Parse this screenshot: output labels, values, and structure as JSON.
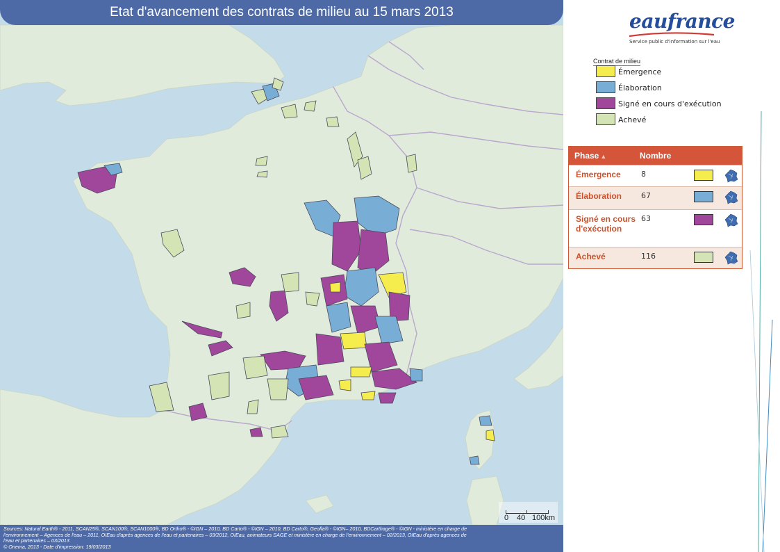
{
  "header": {
    "title": "Etat d'avancement des contrats de milieu au 15 mars 2013"
  },
  "brand": {
    "name": "eaufrance",
    "tagline": "Service public d'information sur l'eau"
  },
  "legend": {
    "title": "Contrat de milieu",
    "items": [
      {
        "label": "Émergence",
        "color": "#f5ec4d"
      },
      {
        "label": "Élaboration",
        "color": "#78aed5"
      },
      {
        "label": "Signé en cours d'exécution",
        "color": "#a0479c"
      },
      {
        "label": "Achevé",
        "color": "#d4e4b4"
      }
    ]
  },
  "table": {
    "header_phase": "Phase",
    "header_nombre": "Nombre",
    "rows": [
      {
        "phase": "Émergence",
        "count": "8",
        "color": "#f5ec4d",
        "icon": "france-map-icon"
      },
      {
        "phase": "Élaboration",
        "count": "67",
        "color": "#78aed5",
        "icon": "france-map-icon"
      },
      {
        "phase": "Signé en cours d'exécution",
        "count": "63",
        "color": "#a0479c",
        "icon": "france-map-icon"
      },
      {
        "phase": "Achevé",
        "count": "116",
        "color": "#d4e4b4",
        "icon": "france-map-icon"
      }
    ]
  },
  "map": {
    "scale_labels": [
      "0",
      "40",
      "100km"
    ],
    "colors": {
      "sea": "#c4dbe9",
      "land": "#e1ebdc",
      "border": "#b8a8cc",
      "emergence": "#f5ec4d",
      "elaboration": "#78aed5",
      "signe": "#a0479c",
      "acheve": "#d4e4b4"
    }
  },
  "sources": {
    "line1": "Sources: Natural Earth® - 2011, SCAN25®, SCAN100®, SCAN1000®, BD Ortho® - ©IGN – 2010, BD Carto® - ©IGN – 2010, BD Carto®, Geofla® - ©IGN– 2010, BDCarthage® - ©IGN - ministère en charge de",
    "line2": "l'environnement – Agences de l'eau – 2011, OIEau d'après agences de l'eau et partenaires – 03/2012, OIEau, animateurs SAGE et ministère en charge de l'environnement – 02/2013, OIEau d'après agences de",
    "line3": "l'eau et partenaires – 03/2013",
    "line4": "© Onema, 2013 - Date d'impression: 19/03/2013"
  }
}
